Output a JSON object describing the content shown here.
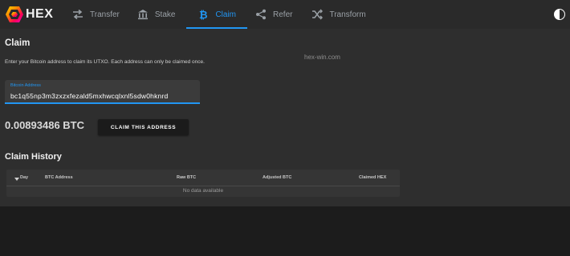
{
  "app": {
    "name": "HEX"
  },
  "nav": {
    "items": [
      {
        "label": "Transfer",
        "icon": "transfer-icon",
        "active": false
      },
      {
        "label": "Stake",
        "icon": "bank-icon",
        "active": false
      },
      {
        "label": "Claim",
        "icon": "bitcoin-icon",
        "active": true
      },
      {
        "label": "Refer",
        "icon": "share-icon",
        "active": false
      },
      {
        "label": "Transform",
        "icon": "shuffle-icon",
        "active": false
      }
    ]
  },
  "claim": {
    "title": "Claim",
    "instructions": "Enter your Bitcoin address to claim its UTXO. Each address can only be claimed once.",
    "watermark": "hex-win.com",
    "address_label": "Bitcoin Address",
    "address_value": "bc1q55np3m3zxzxfezald5mxhwcqlxnl5sdw0hknrd",
    "amount": "0.00893486 BTC",
    "button_label": "CLAIM THIS ADDRESS"
  },
  "history": {
    "title": "Claim History",
    "columns": [
      "Day",
      "BTC Address",
      "Raw BTC",
      "Adjusted BTC",
      "Claimed HEX"
    ],
    "empty_text": "No data available"
  },
  "colors": {
    "accent": "#2196f3",
    "background": "#2e2e2e",
    "topbar": "#2a2a2a"
  }
}
